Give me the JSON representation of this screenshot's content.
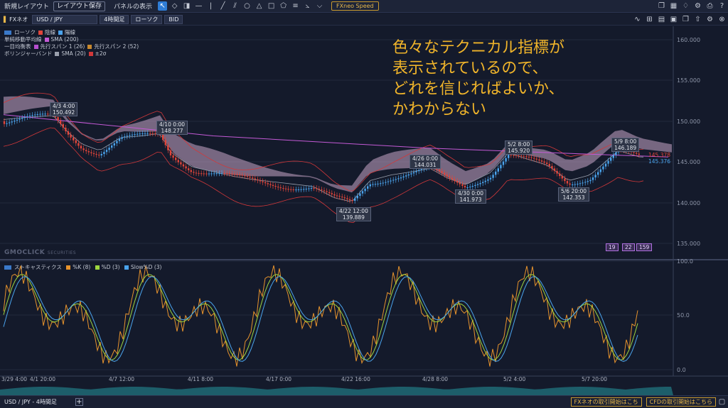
{
  "topbar": {
    "menus": [
      "新規レイアウト",
      "レイアウト保存",
      "パネルの表示"
    ],
    "speed_label": "FXneo Speed"
  },
  "toolbar2": {
    "account": "FXネオ",
    "symbol": "USD / JPY",
    "timeframe": "4時間足",
    "chart_type": "ローソク",
    "side": "BID"
  },
  "legend_main": {
    "candle": "ローソク",
    "bear": "陰線",
    "bull": "陽線",
    "sma_group": "単純移動平均線",
    "sma200": "SMA (200)",
    "ichimoku": "一目均衡表",
    "span1": "先行スパン 1 (26)",
    "span2": "先行スパン 2 (52)",
    "bollinger": "ボリンジャーバンド",
    "sma20": "SMA (20)",
    "sigma": "±2σ"
  },
  "legend_stoch": {
    "title": "ストキャスティクス",
    "k": "%K (8)",
    "d": "%D (3)",
    "slow": "Slow%D (3)"
  },
  "price_axis": [
    "160.000",
    "155.000",
    "150.000",
    "145.000",
    "140.000",
    "135.000"
  ],
  "price_tags": [
    "145.378",
    "145.376"
  ],
  "stoch_axis": [
    "100.0",
    "50.0",
    "0.0"
  ],
  "annotations": [
    {
      "time": "4/3 4:00",
      "price": "150.492"
    },
    {
      "time": "4/10 0:00",
      "price": "148.277"
    },
    {
      "time": "4/22 12:00",
      "price": "139.889"
    },
    {
      "time": "4/26 0:00",
      "price": "144.031"
    },
    {
      "time": "4/30 0:00",
      "price": "141.973"
    },
    {
      "time": "5/2 8:00",
      "price": "145.920"
    },
    {
      "time": "5/6 20:00",
      "price": "142.353"
    },
    {
      "time": "5/9 8:00",
      "price": "146.189"
    }
  ],
  "x_axis": [
    "3/29 4:00",
    "4/1 20:00",
    "4/7 12:00",
    "4/11 8:00",
    "4/17 0:00",
    "4/22 16:00",
    "4/28 8:00",
    "5/2 4:00",
    "5/7 20:00"
  ],
  "badges": [
    "19",
    "22",
    "159"
  ],
  "watermark": "GMOCLICK",
  "watermark_sub": "SECURITIES",
  "overlay_text": [
    "色々なテクニカル指標が",
    "表示されているので、",
    "どれを信じればよいか、",
    "かわからない"
  ],
  "status": {
    "tab": "USD / JPY - 4時間足",
    "cta_fx": "FXネオの取引開始はこち",
    "cta_cfd": "CFDの取引開始はこちら"
  },
  "colors": {
    "bear": "#e0453a",
    "bull": "#4aa3ec",
    "sma200": "#c45ad6",
    "span1": "#b64fd0",
    "span2": "#c8892e",
    "sma20": "#9aa0ad",
    "band": "#d2383a",
    "stoch_k": "#e7932c",
    "stoch_d": "#9dd63f",
    "stoch_slow": "#4aa3ec"
  }
}
